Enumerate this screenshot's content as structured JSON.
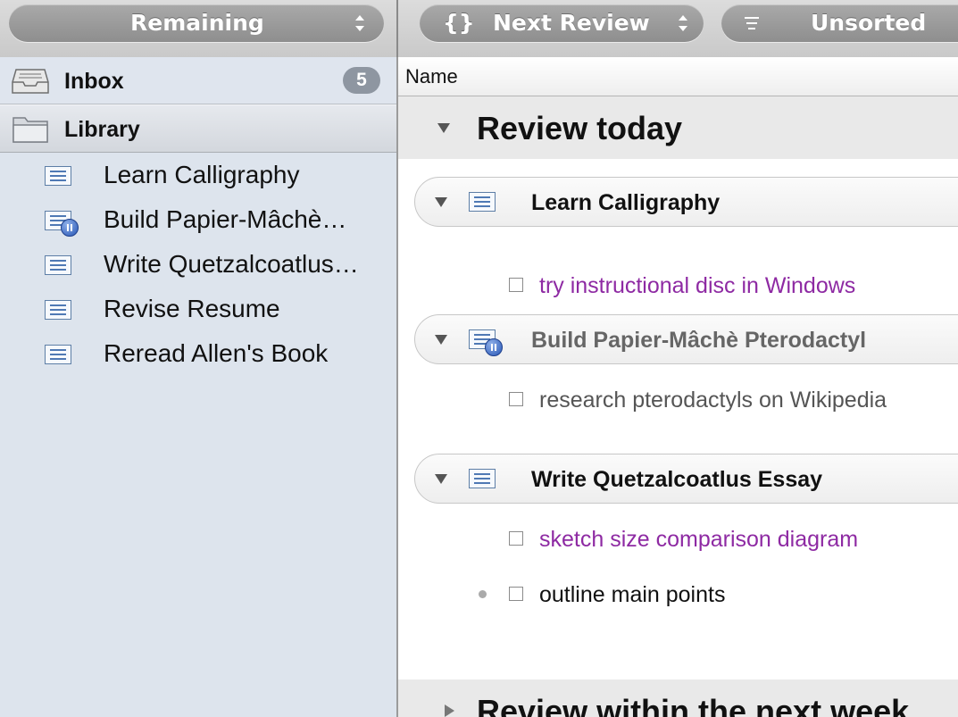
{
  "toolbar": {
    "left_filter": "Remaining",
    "group_filter": "Next Review",
    "group_icon": "{}",
    "sort_filter": "Unsorted"
  },
  "sidebar": {
    "inbox": {
      "label": "Inbox",
      "count": "5"
    },
    "library": {
      "label": "Library"
    },
    "projects": [
      {
        "label": "Learn Calligraphy",
        "on_hold": false
      },
      {
        "label": "Build Papier-Mâchè…",
        "on_hold": true
      },
      {
        "label": "Write Quetzalcoatlus…",
        "on_hold": false
      },
      {
        "label": "Revise Resume",
        "on_hold": false
      },
      {
        "label": "Reread Allen's Book",
        "on_hold": false
      }
    ]
  },
  "main": {
    "column_header": "Name",
    "groups": [
      {
        "title": "Review today"
      },
      {
        "title": "Review within the next week"
      }
    ],
    "projects": [
      {
        "name": "Learn Calligraphy",
        "tasks": [
          {
            "text": "try instructional disc in Windows",
            "color": "#8e2aa3"
          }
        ]
      },
      {
        "name": "Build Papier-Mâchè Pterodactyl",
        "tasks": [
          {
            "text": "research pterodactyls on Wikipedia",
            "color": "#555555"
          }
        ]
      },
      {
        "name": "Write Quetzalcoatlus Essay",
        "tasks": [
          {
            "text": "sketch size comparison diagram",
            "color": "#8e2aa3"
          },
          {
            "text": "outline main points",
            "color": "#111111"
          }
        ]
      }
    ]
  },
  "icons": [
    "sort-arrows-icon",
    "group-braces-icon",
    "menu-lines-icon",
    "inbox-tray-icon",
    "folder-icon",
    "project-list-icon",
    "pause-badge-icon",
    "disclosure-triangle-icon",
    "checkbox-icon",
    "bullet-dot-icon"
  ]
}
